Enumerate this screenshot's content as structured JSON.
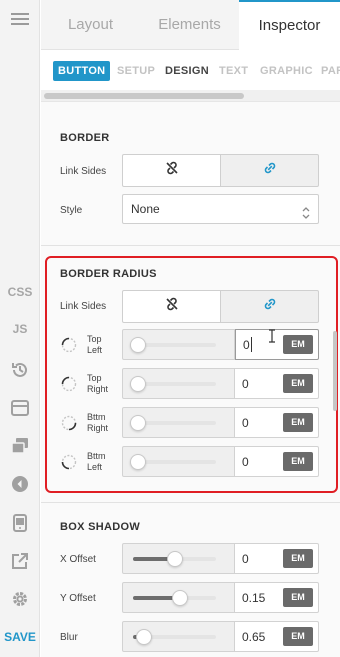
{
  "rail": {
    "css_label": "CSS",
    "js_label": "JS",
    "save_label": "SAVE",
    "icons": [
      "menu-icon",
      "history-icon",
      "layout-icon",
      "layers-icon",
      "arrow-left-icon",
      "device-icon",
      "external-link-icon",
      "gear-icon"
    ]
  },
  "tabs": [
    {
      "label": "Layout"
    },
    {
      "label": "Elements"
    },
    {
      "label": "Inspector"
    }
  ],
  "subtabs": [
    {
      "label": "BUTTON"
    },
    {
      "label": "SETUP"
    },
    {
      "label": "DESIGN"
    },
    {
      "label": "TEXT"
    },
    {
      "label": "GRAPHIC"
    },
    {
      "label": "PAR"
    }
  ],
  "border": {
    "title": "BORDER",
    "link_sides_label": "Link Sides",
    "style_label": "Style",
    "style_value": "None"
  },
  "border_radius": {
    "title": "BORDER RADIUS",
    "link_sides_label": "Link Sides",
    "corners": [
      {
        "label_1": "Top",
        "label_2": "Left",
        "value": "0",
        "unit": "EM",
        "slider": 0
      },
      {
        "label_1": "Top",
        "label_2": "Right",
        "value": "0",
        "unit": "EM",
        "slider": 0
      },
      {
        "label_1": "Bttm",
        "label_2": "Right",
        "value": "0",
        "unit": "EM",
        "slider": 0
      },
      {
        "label_1": "Bttm",
        "label_2": "Left",
        "value": "0",
        "unit": "EM",
        "slider": 0
      }
    ]
  },
  "box_shadow": {
    "title": "BOX SHADOW",
    "rows": [
      {
        "label": "X Offset",
        "value": "0",
        "unit": "EM",
        "slider": 0.5
      },
      {
        "label": "Y Offset",
        "value": "0.15",
        "unit": "EM",
        "slider": 0.58
      },
      {
        "label": "Blur",
        "value": "0.65",
        "unit": "EM",
        "slider": 0.08
      }
    ]
  },
  "colors": {
    "accent": "#2196c9",
    "highlight": "#e01e24"
  }
}
